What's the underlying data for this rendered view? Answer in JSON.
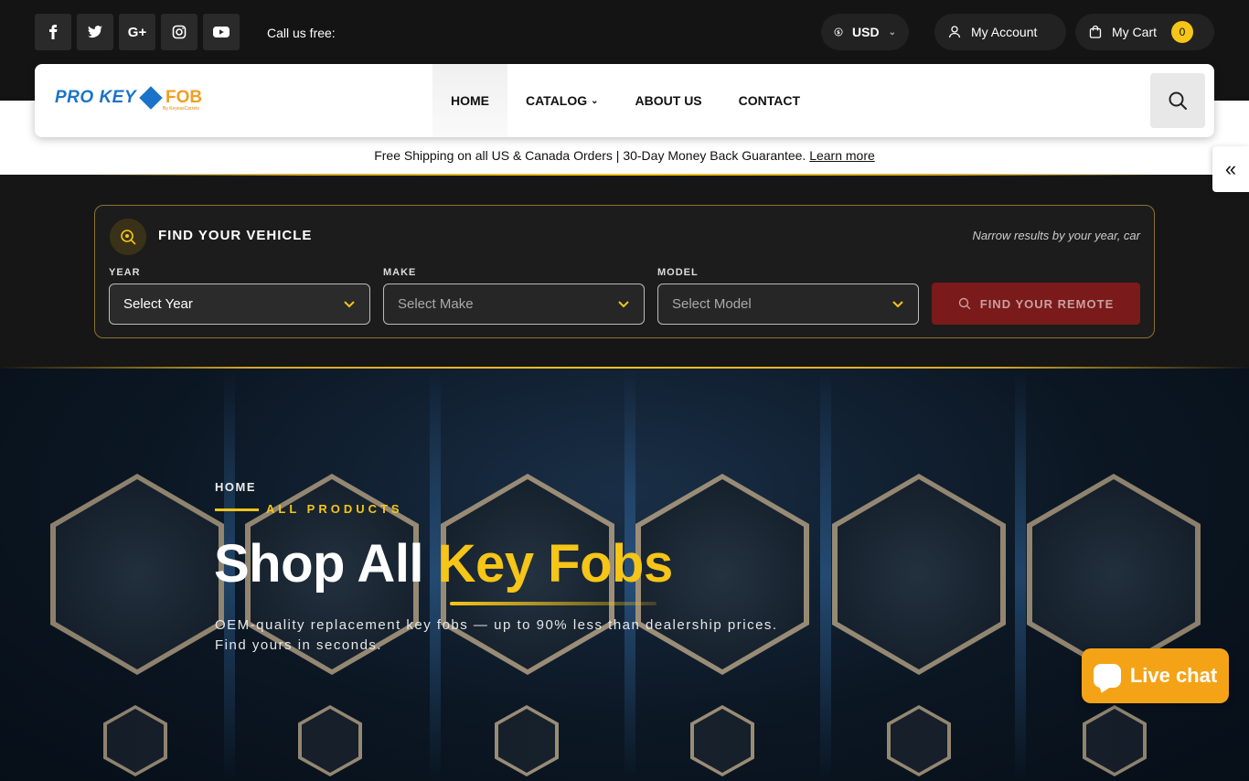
{
  "topbar": {
    "social": [
      {
        "name": "facebook-icon",
        "glyph": "f"
      },
      {
        "name": "twitter-icon",
        "glyph": "t"
      },
      {
        "name": "google-plus-icon",
        "glyph": "G+"
      },
      {
        "name": "instagram-icon",
        "glyph": "ig"
      },
      {
        "name": "youtube-icon",
        "glyph": "yt"
      }
    ],
    "call_label": "Call us free:",
    "currency": "USD",
    "account_label": "My Account",
    "cart_label": "My Cart",
    "cart_count": "0"
  },
  "header": {
    "logo_pro": "PRO KEY",
    "logo_fob": "FOB",
    "logo_tag": "By KeyessCarrets",
    "nav": [
      {
        "label": "HOME",
        "active": true
      },
      {
        "label": "CATALOG",
        "caret": "⌄"
      },
      {
        "label": "ABOUT US"
      },
      {
        "label": "CONTACT"
      }
    ]
  },
  "announce": {
    "text": "Free Shipping on all US & Canada Orders | 30-Day Money Back Guarantee. ",
    "link": "Learn more"
  },
  "side_toggle": "«",
  "finder": {
    "title": "FIND YOUR VEHICLE",
    "hint": "Narrow results by your year, car",
    "year_label": "YEAR",
    "year_value": "Select Year",
    "make_label": "MAKE",
    "make_value": "Select Make",
    "model_label": "MODEL",
    "model_value": "Select Model",
    "button": "FIND YOUR REMOTE"
  },
  "hero": {
    "breadcrumb": "HOME",
    "eyebrow": "ALL PRODUCTS",
    "headline_plain": "Shop All ",
    "headline_accent": "Key Fobs",
    "sub_line1": "OEM-quality replacement key fobs — up to 90% less than dealership prices.",
    "sub_line2": "Find yours in seconds."
  },
  "chat": {
    "label": "Live chat"
  },
  "colors": {
    "accent": "#f5c518",
    "button_red": "#7a1a1a",
    "chat_orange": "#f5a316"
  }
}
